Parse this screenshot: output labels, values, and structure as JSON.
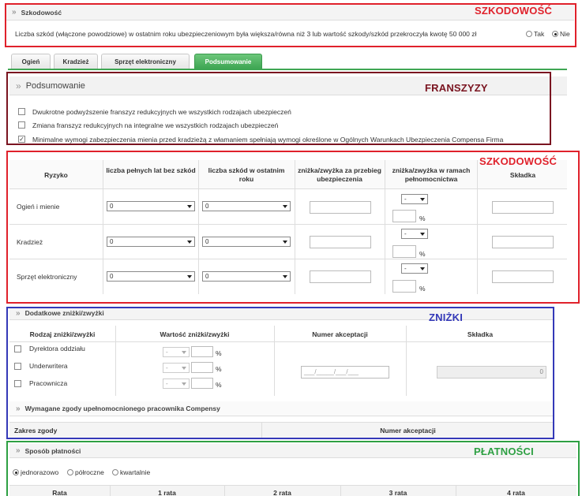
{
  "annotations": {
    "szkodowosc_top": "SZKODOWOŚĆ",
    "franszyzy": "FRANSZYZY",
    "szkodowosc_table": "SZKODOWOŚĆ",
    "znizki": "ZNIŻKI",
    "platnosci": "PŁATNOŚCI"
  },
  "szkodowosc": {
    "title": "Szkodowość",
    "question": "Liczba szkód (włączone powodziowe) w ostatnim roku ubezpieczeniowym była większa/równa niż 3 lub wartość szkody/szkód przekroczyła kwotę 50 000 zł",
    "opt_yes": "Tak",
    "opt_no": "Nie",
    "selected": "Nie"
  },
  "tabs": [
    {
      "label": "Ogień"
    },
    {
      "label": "Kradzież"
    },
    {
      "label": "Sprzęt elektroniczny"
    },
    {
      "label": "Podsumowanie"
    }
  ],
  "active_tab": "Podsumowanie",
  "podsumowanie": {
    "title": "Podsumowanie",
    "options": [
      {
        "label": "Dwukrotne podwyższenie franszyz redukcyjnych we wszystkich rodzajach ubezpieczeń",
        "checked": false
      },
      {
        "label": "Zmiana franszyz redukcyjnych na integralne we wszystkich rodzajach ubezpieczeń",
        "checked": false
      },
      {
        "label": "Minimalne wymogi zabezpieczenia mienia przed kradzieżą z włamaniem spełniają wymogi określone w Ogólnych Warunkach Ubezpieczenia Compensa Firma",
        "checked": true
      }
    ]
  },
  "risk_table": {
    "headers": {
      "ryzyko": "Ryzyko",
      "lat": "liczba pełnych lat bez szkód",
      "szkod": "liczba szkód w ostatnim roku",
      "przebieg": "zniżka/zwyżka za przebieg ubezpieczenia",
      "pelnomocnictwo": "zniżka/zwyżka w ramach pełnomocnictwa",
      "skladka": "Składka"
    },
    "rows": [
      {
        "name": "Ogień i mienie",
        "lat": "0",
        "szkod": "0",
        "sign": "-",
        "pct": "%"
      },
      {
        "name": "Kradzież",
        "lat": "0",
        "szkod": "0",
        "sign": "-",
        "pct": "%"
      },
      {
        "name": "Sprzęt elektroniczny",
        "lat": "0",
        "szkod": "0",
        "sign": "-",
        "pct": "%"
      }
    ]
  },
  "znizki": {
    "title": "Dodatkowe zniżki/zwyżki",
    "headers": {
      "rodzaj": "Rodzaj zniżki/zwyżki",
      "wartosc": "Wartość zniżki/zwyżki",
      "numer": "Numer akceptacji",
      "skladka": "Składka"
    },
    "rows": [
      {
        "label": "Dyrektora oddziału",
        "sign": "-",
        "pct": "%"
      },
      {
        "label": "Underwritera",
        "sign": "-",
        "pct": "%"
      },
      {
        "label": "Pracownicza",
        "sign": "-",
        "pct": "%"
      }
    ],
    "accept_placeholder": "___/_____/___/___",
    "skladka_value": "0",
    "zgody_title": "Wymagane zgody upełnomocnionego pracownika Compensy",
    "zgody_headers": {
      "zakres": "Zakres zgody",
      "numer": "Numer akceptacji"
    }
  },
  "platnosci": {
    "title": "Sposób płatności",
    "options": [
      "jednorazowo",
      "półroczne",
      "kwartalnie"
    ],
    "selected": "jednorazowo",
    "table_headers": [
      "Rata",
      "1 rata",
      "2 rata",
      "3 rata",
      "4 rata"
    ]
  }
}
